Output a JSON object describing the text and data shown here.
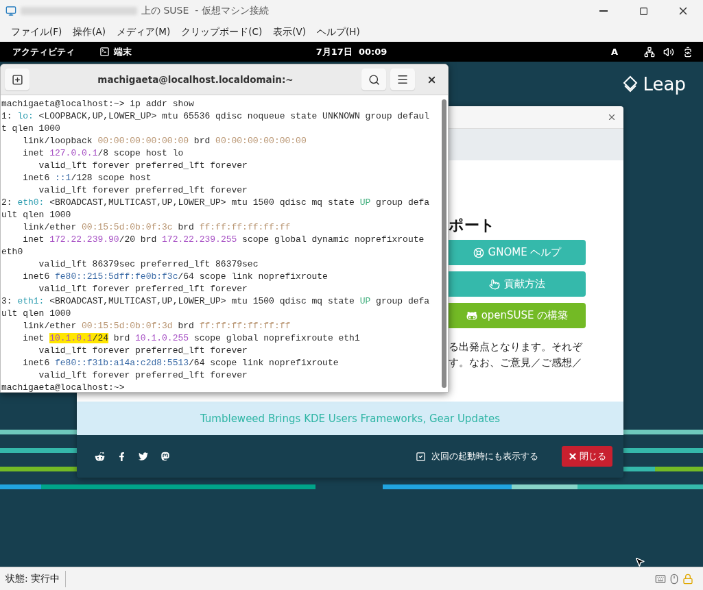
{
  "host_window": {
    "title": "上の SUSE  - 仮想マシン接続",
    "menu": [
      "ファイル(F)",
      "操作(A)",
      "メディア(M)",
      "クリップボード(C)",
      "表示(V)",
      "ヘルプ(H)"
    ],
    "status": "状態: 実行中"
  },
  "top_bar": {
    "activities": "アクティビティ",
    "app": "端末",
    "clock": "7月17日  00:09",
    "input_method": "A"
  },
  "desktop": {
    "logo": "Leap"
  },
  "terminal": {
    "title": "machigaeta@localhost.localdomain:~",
    "lines": [
      [
        {
          "text": "machigaeta@localhost:~> ip addr show",
          "kind": "plain"
        }
      ],
      [
        {
          "text": "1: ",
          "kind": "plain"
        },
        {
          "text": "lo:",
          "kind": "iface"
        },
        {
          "text": " <LOOPBACK,UP,LOWER_UP> mtu 65536 qdisc noqueue state UNKNOWN group defaul",
          "kind": "plain"
        }
      ],
      [
        {
          "text": "t qlen 1000",
          "kind": "plain"
        }
      ],
      [
        {
          "text": "    link/loopback ",
          "kind": "plain"
        },
        {
          "text": "00:00:00:00:00:00",
          "kind": "mac"
        },
        {
          "text": " brd ",
          "kind": "plain"
        },
        {
          "text": "00:00:00:00:00:00",
          "kind": "mac"
        }
      ],
      [
        {
          "text": "    inet ",
          "kind": "plain"
        },
        {
          "text": "127.0.0.1",
          "kind": "ipv4"
        },
        {
          "text": "/8 scope host lo",
          "kind": "plain"
        }
      ],
      [
        {
          "text": "       valid_lft forever preferred_lft forever",
          "kind": "plain"
        }
      ],
      [
        {
          "text": "    inet6 ",
          "kind": "plain"
        },
        {
          "text": "::1",
          "kind": "ipv6"
        },
        {
          "text": "/128 scope host",
          "kind": "plain"
        }
      ],
      [
        {
          "text": "       valid_lft forever preferred_lft forever",
          "kind": "plain"
        }
      ],
      [
        {
          "text": "2: ",
          "kind": "plain"
        },
        {
          "text": "eth0:",
          "kind": "iface"
        },
        {
          "text": " <BROADCAST,MULTICAST,UP,LOWER_UP> mtu 1500 qdisc mq state ",
          "kind": "plain"
        },
        {
          "text": "UP",
          "kind": "state"
        },
        {
          "text": " group defa",
          "kind": "plain"
        }
      ],
      [
        {
          "text": "ult qlen 1000",
          "kind": "plain"
        }
      ],
      [
        {
          "text": "    link/ether ",
          "kind": "plain"
        },
        {
          "text": "00:15:5d:0b:0f:3c",
          "kind": "mac"
        },
        {
          "text": " brd ",
          "kind": "plain"
        },
        {
          "text": "ff:ff:ff:ff:ff:ff",
          "kind": "mac"
        }
      ],
      [
        {
          "text": "    inet ",
          "kind": "plain"
        },
        {
          "text": "172.22.239.90",
          "kind": "ipv4"
        },
        {
          "text": "/20 brd ",
          "kind": "plain"
        },
        {
          "text": "172.22.239.255",
          "kind": "ipv4"
        },
        {
          "text": " scope global dynamic noprefixroute",
          "kind": "plain"
        }
      ],
      [
        {
          "text": "eth0",
          "kind": "plain"
        }
      ],
      [
        {
          "text": "       valid_lft 86379sec preferred_lft 86379sec",
          "kind": "plain"
        }
      ],
      [
        {
          "text": "    inet6 ",
          "kind": "plain"
        },
        {
          "text": "fe80::215:5dff:fe0b:f3c",
          "kind": "ipv6"
        },
        {
          "text": "/64 scope link noprefixroute",
          "kind": "plain"
        }
      ],
      [
        {
          "text": "       valid_lft forever preferred_lft forever",
          "kind": "plain"
        }
      ],
      [
        {
          "text": "3: ",
          "kind": "plain"
        },
        {
          "text": "eth1:",
          "kind": "iface"
        },
        {
          "text": " <BROADCAST,MULTICAST,UP,LOWER_UP> mtu 1500 qdisc mq state ",
          "kind": "plain"
        },
        {
          "text": "UP",
          "kind": "state"
        },
        {
          "text": " group defa",
          "kind": "plain"
        }
      ],
      [
        {
          "text": "ult qlen 1000",
          "kind": "plain"
        }
      ],
      [
        {
          "text": "    link/ether ",
          "kind": "plain"
        },
        {
          "text": "00:15:5d:0b:0f:3d",
          "kind": "mac"
        },
        {
          "text": " brd ",
          "kind": "plain"
        },
        {
          "text": "ff:ff:ff:ff:ff:ff",
          "kind": "mac"
        }
      ],
      [
        {
          "text": "    inet ",
          "kind": "plain"
        },
        {
          "text": "10.1.0.1",
          "kind": "ipv4-marked"
        },
        {
          "text": "/24",
          "kind": "plain-marked"
        },
        {
          "text": " brd ",
          "kind": "plain"
        },
        {
          "text": "10.1.0.255",
          "kind": "ipv4"
        },
        {
          "text": " scope global noprefixroute eth1",
          "kind": "plain"
        }
      ],
      [
        {
          "text": "       valid_lft forever preferred_lft forever",
          "kind": "plain"
        }
      ],
      [
        {
          "text": "    inet6 ",
          "kind": "plain"
        },
        {
          "text": "fe80::f31b:a14a:c2d8:5513",
          "kind": "ipv6"
        },
        {
          "text": "/64 scope link noprefixroute",
          "kind": "plain"
        }
      ],
      [
        {
          "text": "       valid_lft forever preferred_lft forever",
          "kind": "plain"
        }
      ],
      [
        {
          "text": "machigaeta@localhost:~>",
          "kind": "plain"
        }
      ]
    ]
  },
  "welcome_dialog": {
    "heading": "ポート",
    "buttons": [
      {
        "label": "GNOME ヘルプ",
        "kind": "help"
      },
      {
        "label": "貢献方法",
        "kind": "contribute"
      },
      {
        "label": "openSUSE の構築",
        "kind": "build"
      }
    ],
    "paragraph": [
      "る出発点となります。それぞ",
      "す。なお、ご意見／ご感想／"
    ],
    "news": "Tumbleweed Brings KDE Users Frameworks, Gear Updates",
    "show_on_startup": {
      "label": "次回の起動時にも表示する",
      "checked": true
    },
    "close_button": "閉じる"
  }
}
